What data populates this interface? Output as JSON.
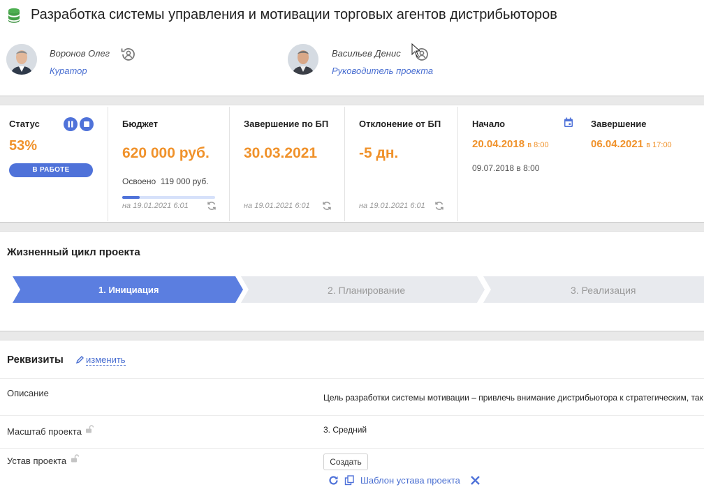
{
  "header": {
    "title": "Разработка системы управления и мотивации торговых агентов дистрибьюторов"
  },
  "people": [
    {
      "name": "Воронов Олег",
      "role": "Куратор"
    },
    {
      "name": "Васильев Денис",
      "role": "Руководитель проекта"
    }
  ],
  "kpi": {
    "status": {
      "label": "Статус",
      "percent": "53%",
      "badge": "В РАБОТЕ"
    },
    "budget": {
      "label": "Бюджет",
      "value": "620 000 руб.",
      "spent_label": "Освоено",
      "spent_value": "119 000 руб.",
      "spent_fraction": 0.19,
      "updated": "на 19.01.2021 6:01"
    },
    "finish_bp": {
      "label": "Завершение по БП",
      "value": "30.03.2021",
      "updated": "на 19.01.2021 6:01"
    },
    "deviation": {
      "label": "Отклонение от БП",
      "value": "-5 дн.",
      "updated": "на 19.01.2021 6:01"
    },
    "start": {
      "label": "Начало",
      "value": "20.04.2018",
      "time": "в 8:00",
      "secondary": "09.07.2018 в 8:00"
    },
    "end": {
      "label": "Завершение",
      "value": "06.04.2021",
      "time": "в 17:00"
    }
  },
  "lifecycle": {
    "title": "Жизненный цикл проекта",
    "stages": [
      {
        "label": "1. Инициация",
        "active": true
      },
      {
        "label": "2. Планирование",
        "active": false
      },
      {
        "label": "3. Реализация",
        "active": false
      }
    ]
  },
  "requisites": {
    "title": "Реквизиты",
    "edit_label": "изменить",
    "rows": [
      {
        "label": "Описание",
        "value": "Цель разработки системы мотивации – привлечь внимание дистрибьютора к стратегическим, так"
      },
      {
        "label": "Масштаб проекта",
        "value": "3. Средний"
      },
      {
        "label": "Устав проекта",
        "value": ""
      }
    ],
    "create_label": "Создать",
    "template_label": "Шаблон устава проекта"
  },
  "colors": {
    "accent": "#4f72d9",
    "orange": "#f0922b",
    "separator": "#e9e9e9"
  },
  "icons": [
    "database-icon",
    "user-switch-icon",
    "pause-icon",
    "stop-icon",
    "refresh-icon",
    "calendar-icon",
    "pencil-icon",
    "lock-icon",
    "copy-icon",
    "close-icon",
    "cursor-icon"
  ]
}
